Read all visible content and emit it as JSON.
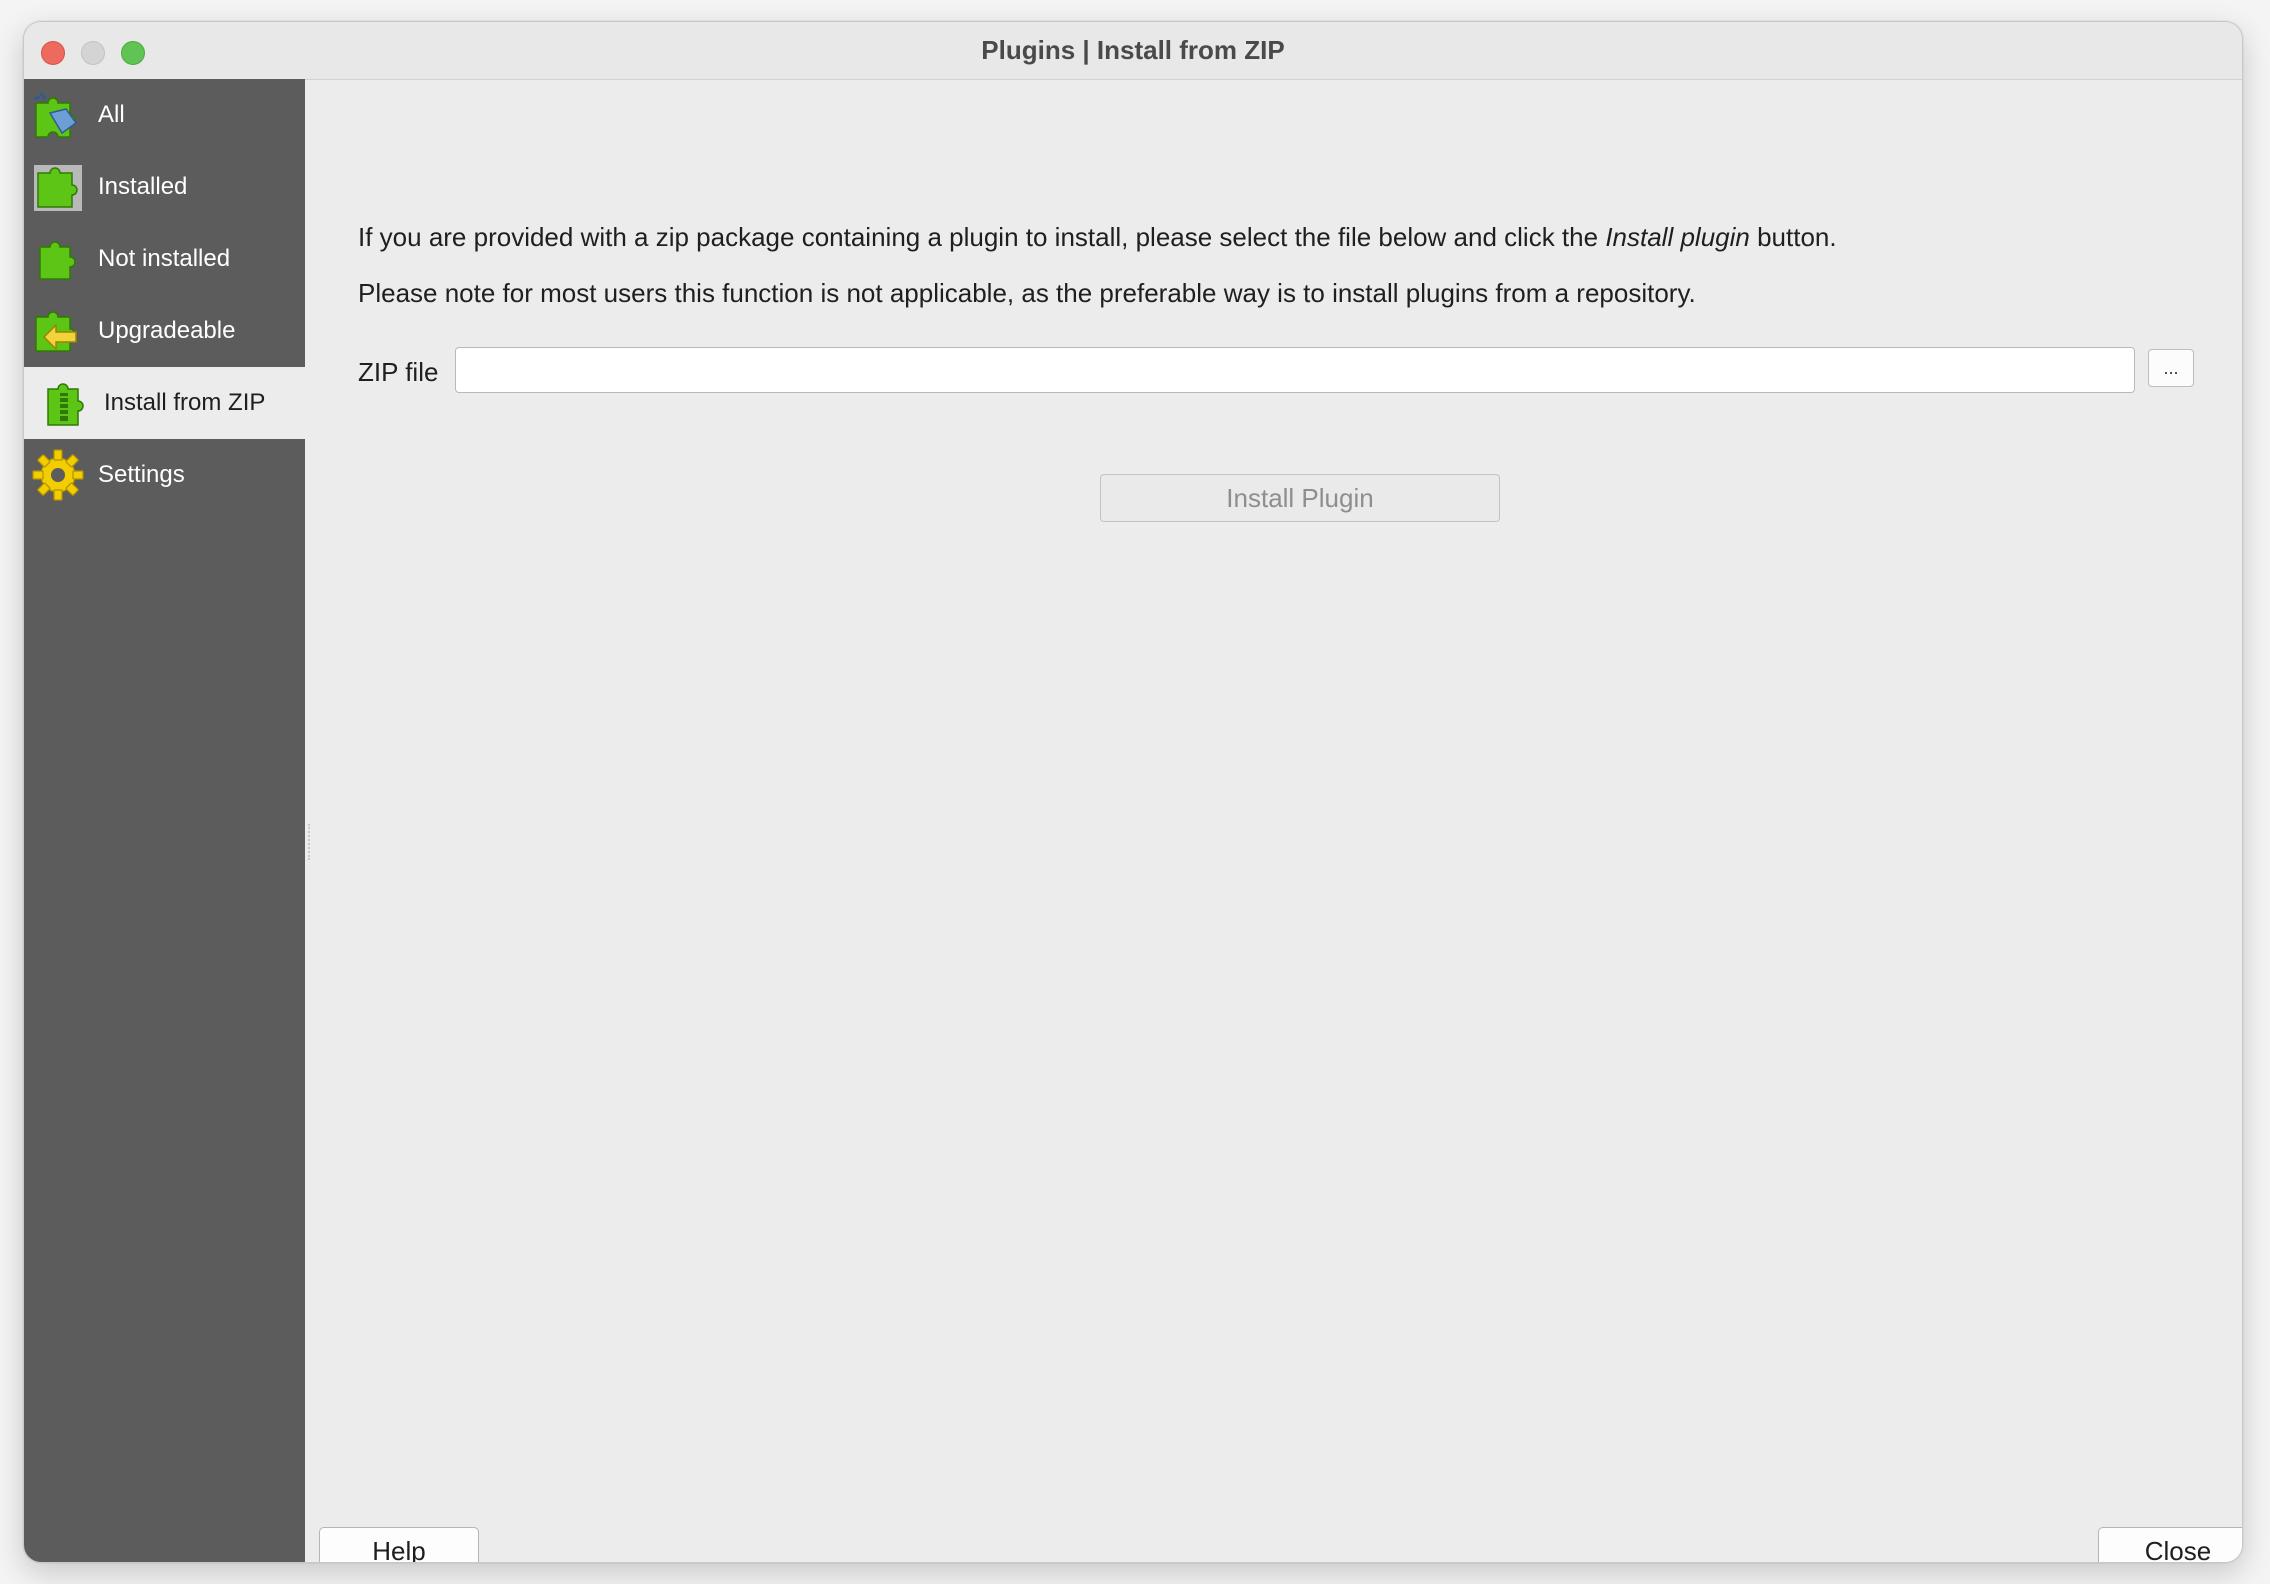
{
  "window": {
    "title": "Plugins | Install from ZIP"
  },
  "sidebar": {
    "items": [
      {
        "label": "All",
        "icon": "plugin-all-icon"
      },
      {
        "label": "Installed",
        "icon": "plugin-installed-icon"
      },
      {
        "label": "Not installed",
        "icon": "plugin-not-installed-icon"
      },
      {
        "label": "Upgradeable",
        "icon": "plugin-upgradeable-icon"
      },
      {
        "label": "Install from ZIP",
        "icon": "plugin-zip-icon",
        "selected": true
      },
      {
        "label": "Settings",
        "icon": "gear-icon"
      }
    ]
  },
  "main": {
    "intro_part1": "If you are provided with a zip package containing a plugin to install, please select the file below and click the ",
    "intro_emphasis": "Install plugin",
    "intro_part2": " button.",
    "note": "Please note for most users this function is not applicable, as the preferable way is to install plugins from a repository.",
    "zip_label": "ZIP file",
    "zip_value": "",
    "browse_label": "...",
    "install_label": "Install Plugin"
  },
  "footer": {
    "help_label": "Help",
    "close_label": "Close"
  },
  "colors": {
    "sidebar_bg": "#5c5c5c",
    "content_bg": "#ececec",
    "plugin_green": "#5cc515",
    "gear_yellow": "#f2cd00",
    "upgrade_yellow": "#f1d33c",
    "all_blue": "#6d9fd6"
  }
}
